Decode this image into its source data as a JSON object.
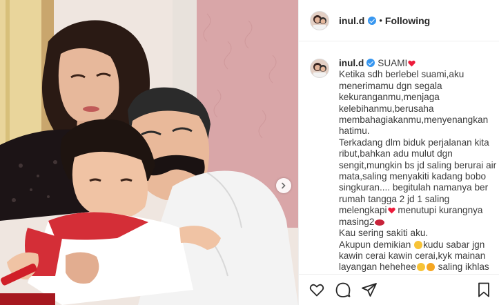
{
  "post": {
    "username": "inul.d",
    "separator": "•",
    "follow_status": "Following"
  },
  "caption": {
    "username": "inul.d",
    "lines": [
      "SUAMI",
      "Ketika sdh berlebel suami,aku",
      "menerimamu dgn segala",
      "kekuranganmu,menjaga",
      "kelebihanmu,berusaha",
      "membahagiakanmu,menyenangkan",
      "hatimu.",
      "Terkadang dlm biduk perjalanan kita",
      "ribut,bahkan adu mulut dgn",
      "sengit,mungkin bs jd saling berurai air",
      "mata,saling menyakiti kadang bobo",
      "singkuran.... begitulah namanya ber",
      "rumah tangga 2 jd 1 saling",
      "melengkapi",
      "menutupi kurangnya",
      "masing2",
      "Kau sering sakiti aku.",
      "Akupun demikian",
      "kudu sabar jgn",
      "kawin cerai kawin cerai,kyk mainan",
      "layangan hehehee",
      "saling ikhlas"
    ]
  },
  "icons": {
    "verified": "verified-badge-icon",
    "heart_emoji": "red-heart-emoji",
    "carousel": "chevron-right-icon",
    "like": "heart-outline-icon",
    "comment": "comment-bubble-icon",
    "share": "paper-plane-icon",
    "save": "bookmark-icon"
  },
  "colors": {
    "verified": "#3897f0",
    "heart": "#ed1c3b",
    "text": "#262626",
    "border": "#efefef"
  }
}
